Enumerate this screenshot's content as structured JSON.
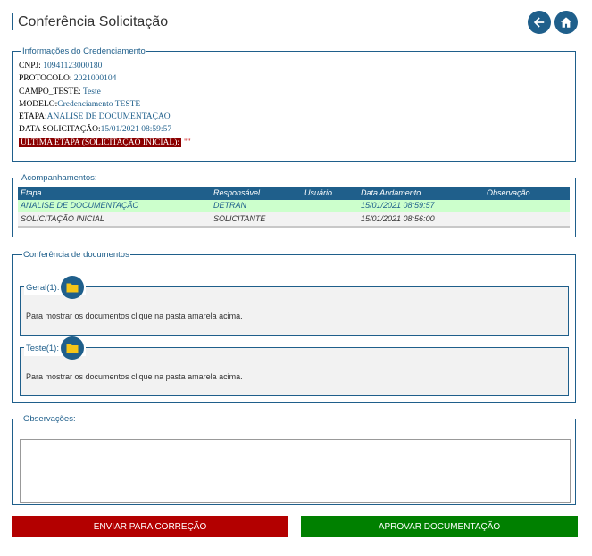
{
  "header": {
    "title": "Conferência Solicitação"
  },
  "credenciamento": {
    "legend": "Informações do Credenciamento",
    "cnpj_label": "CNPJ:",
    "cnpj_value": "10941123000180",
    "protocolo_label": "PROTOCOLO:",
    "protocolo_value": "2021000104",
    "campo_teste_label": "CAMPO_TESTE:",
    "campo_teste_value": "Teste",
    "modelo_label": "MODELO:",
    "modelo_value": "Credenciamento TESTE",
    "etapa_label": "ETAPA:",
    "etapa_value": "ANALISE DE DOCUMENTAÇÃO",
    "data_label": "DATA SOLICITAÇÃO:",
    "data_value": "15/01/2021 08:59:57",
    "ultima_label": "ULTIMA ETAPA (SOLICITAÇÃO INICIAL):",
    "ultima_value": "\"\""
  },
  "acompanhamentos": {
    "legend": "Acompanhamentos:",
    "columns": [
      "Etapa",
      "Responsável",
      "Usuário",
      "Data Andamento",
      "Observação"
    ],
    "rows": [
      [
        "ANALISE DE DOCUMENTAÇÃO",
        "DETRAN",
        "",
        "15/01/2021 08:59:57",
        ""
      ],
      [
        "SOLICITAÇÃO INICIAL",
        "SOLICITANTE",
        "",
        "15/01/2021 08:56:00",
        ""
      ]
    ]
  },
  "conferencia": {
    "legend": "Conferência de documentos",
    "groups": [
      {
        "label": "Geral(1):",
        "message": "Para mostrar os documentos clique na pasta amarela acima."
      },
      {
        "label": "Teste(1):",
        "message": "Para mostrar os documentos clique na pasta amarela acima."
      }
    ]
  },
  "observacoes": {
    "legend": "Observações:",
    "value": ""
  },
  "actions": {
    "reject_label": "ENVIAR PARA CORREÇÃO",
    "approve_label": "APROVAR DOCUMENTAÇÃO"
  },
  "colors": {
    "primary": "#1f5f8b",
    "reject": "#b30000",
    "approve": "#008000",
    "highlight_row": "#ccffcc",
    "folder": "#f5c518"
  },
  "icons": {
    "back": "arrow-left-icon",
    "home": "home-icon",
    "folder": "folder-icon"
  }
}
